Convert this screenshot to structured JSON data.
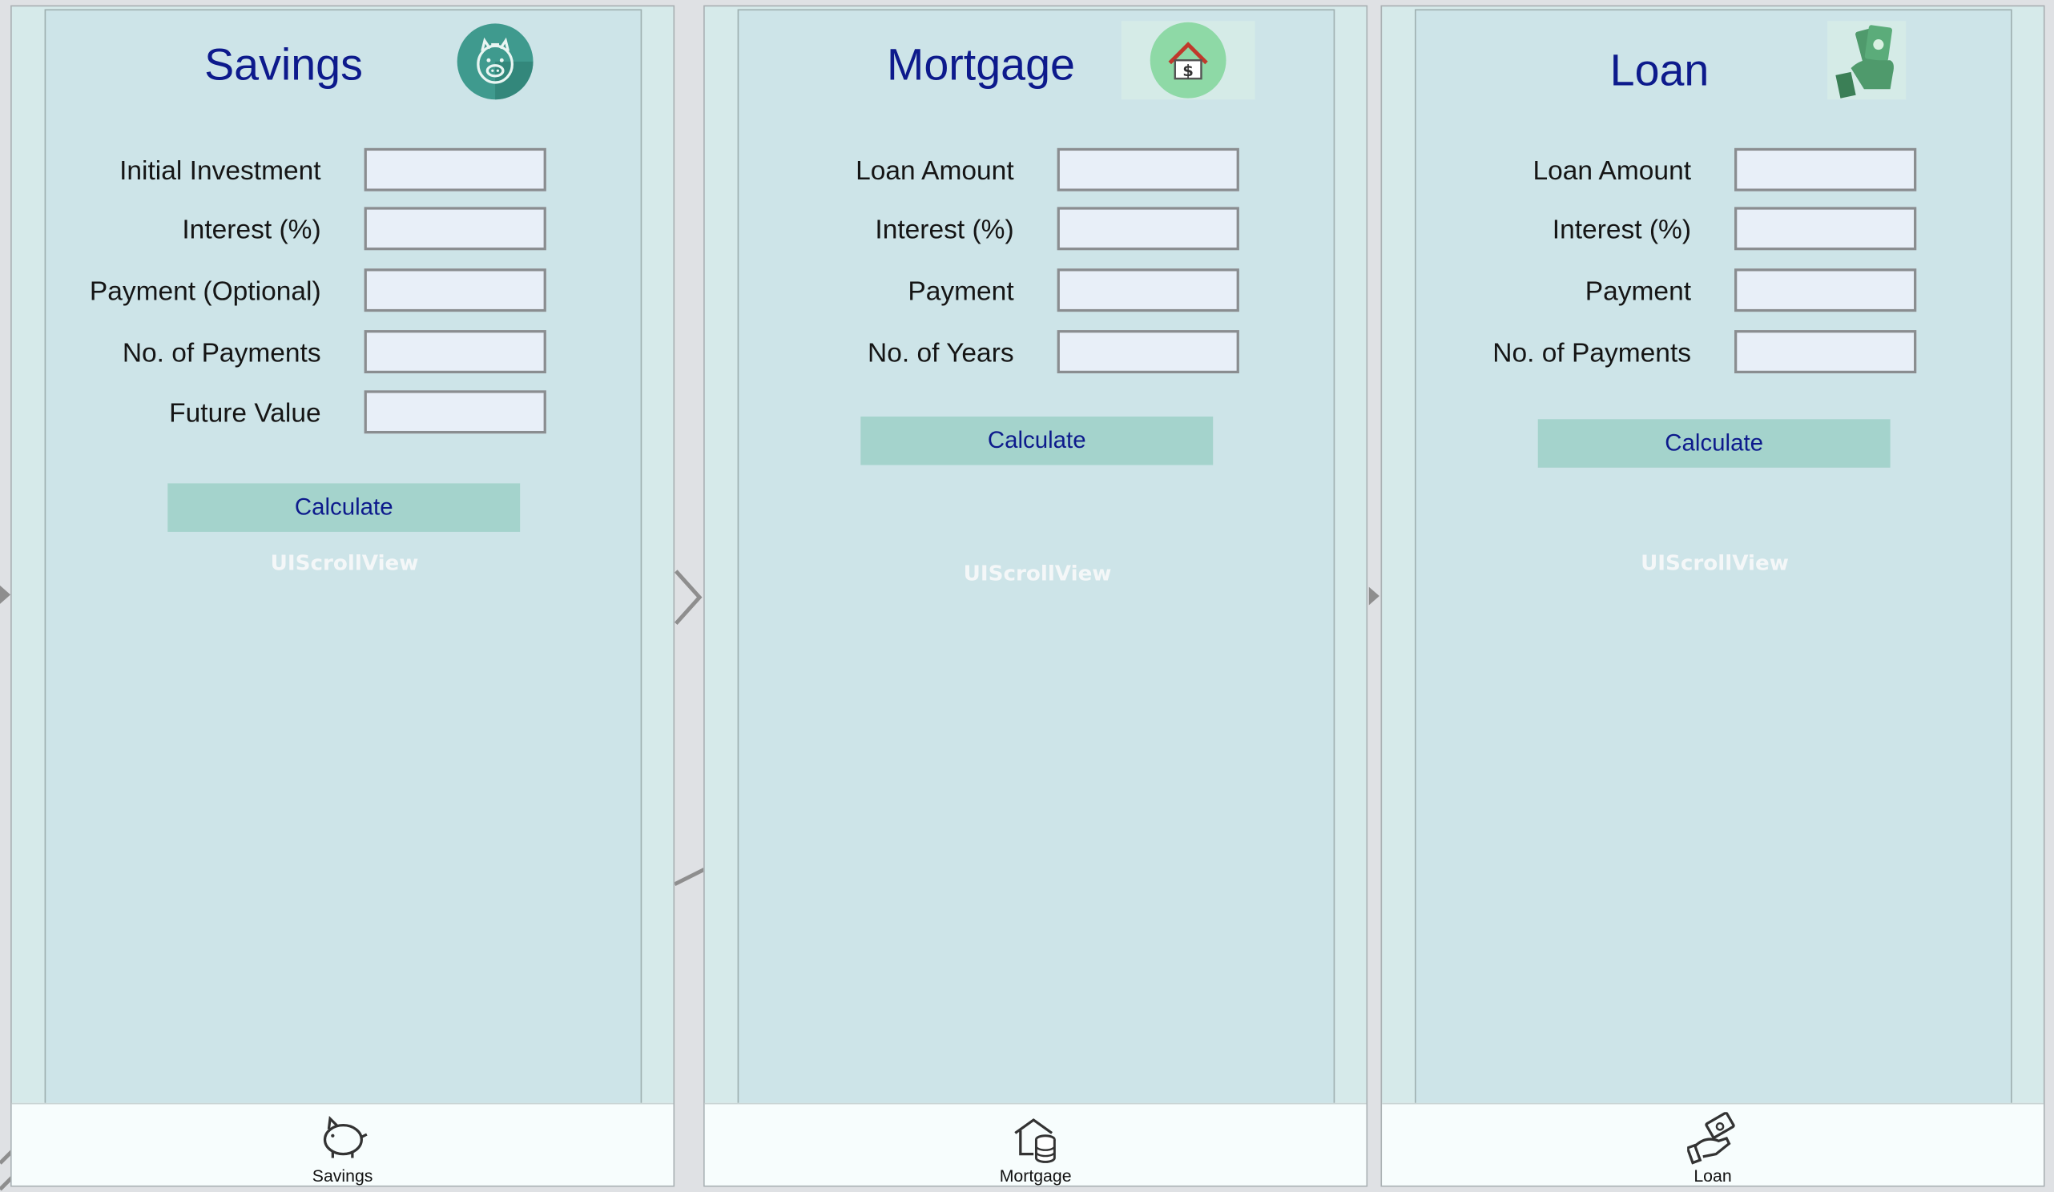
{
  "screens": [
    {
      "title": "Savings",
      "icon": "piggy-bank-icon",
      "fields": [
        {
          "label": "Initial Investment",
          "value": ""
        },
        {
          "label": "Interest (%)",
          "value": ""
        },
        {
          "label": "Payment (Optional)",
          "value": ""
        },
        {
          "label": "No. of Payments",
          "value": ""
        },
        {
          "label": "Future Value",
          "value": ""
        }
      ],
      "button": "Calculate",
      "scroll_label": "UIScrollView",
      "tab_label": "Savings",
      "tab_icon": "piggy-bank-icon"
    },
    {
      "title": "Mortgage",
      "icon": "house-dollar-icon",
      "fields": [
        {
          "label": "Loan Amount",
          "value": ""
        },
        {
          "label": "Interest (%)",
          "value": ""
        },
        {
          "label": "Payment",
          "value": ""
        },
        {
          "label": "No. of Years",
          "value": ""
        }
      ],
      "button": "Calculate",
      "scroll_label": "UIScrollView",
      "tab_label": "Mortgage",
      "tab_icon": "house-coins-icon"
    },
    {
      "title": "Loan",
      "icon": "cash-hand-icon",
      "fields": [
        {
          "label": "Loan Amount",
          "value": ""
        },
        {
          "label": "Interest (%)",
          "value": ""
        },
        {
          "label": "Payment",
          "value": ""
        },
        {
          "label": "No. of Payments",
          "value": ""
        }
      ],
      "button": "Calculate",
      "scroll_label": "UIScrollView",
      "tab_label": "Loan",
      "tab_icon": "hand-money-icon"
    }
  ],
  "colors": {
    "title": "#0d1a8c",
    "button": "#a4d3cc",
    "scroll_bg": "#cde4e8",
    "field_bg": "#e8eff8"
  }
}
